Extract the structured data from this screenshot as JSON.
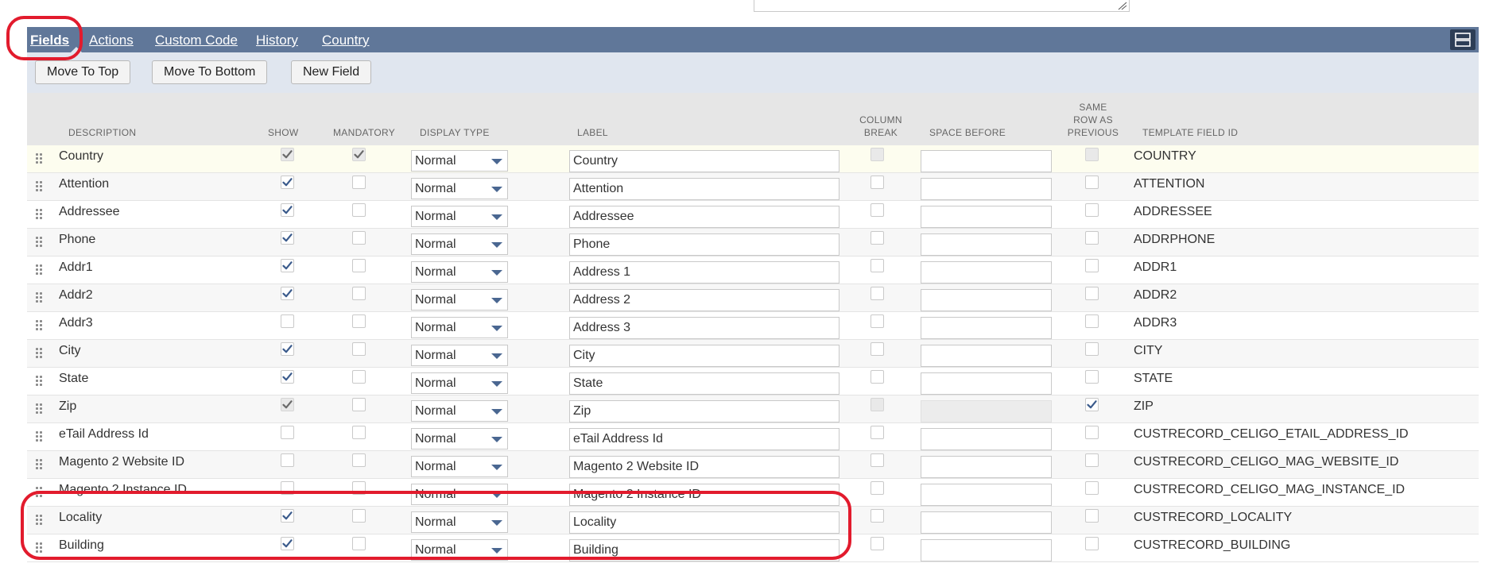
{
  "tabs": [
    {
      "label": "Fields",
      "active": true
    },
    {
      "label": "Actions",
      "active": false
    },
    {
      "label": "Custom Code",
      "active": false
    },
    {
      "label": "History",
      "active": false
    },
    {
      "label": "Country",
      "active": false
    }
  ],
  "toolbar": {
    "move_top_label": "Move To Top",
    "move_bottom_label": "Move To Bottom",
    "new_field_label": "New Field"
  },
  "columns": {
    "description": "DESCRIPTION",
    "show": "SHOW",
    "mandatory": "MANDATORY",
    "display_type": "DISPLAY TYPE",
    "label": "LABEL",
    "column_break_1": "COLUMN",
    "column_break_2": "BREAK",
    "space_before": "SPACE BEFORE",
    "same_row_1": "SAME",
    "same_row_2": "ROW AS",
    "same_row_3": "PREVIOUS",
    "template_field_id": "TEMPLATE FIELD ID"
  },
  "rows": [
    {
      "description": "Country",
      "show": true,
      "show_disabled": true,
      "mandatory": true,
      "mandatory_disabled": true,
      "display_type": "Normal",
      "label": "Country",
      "column_break_disabled": true,
      "space_before": "",
      "space_disabled": false,
      "same_row": false,
      "same_row_disabled": true,
      "template_field_id": "COUNTRY"
    },
    {
      "description": "Attention",
      "show": true,
      "show_disabled": false,
      "mandatory": false,
      "mandatory_disabled": false,
      "display_type": "Normal",
      "label": "Attention",
      "column_break_disabled": false,
      "space_before": "",
      "space_disabled": false,
      "same_row": false,
      "same_row_disabled": false,
      "template_field_id": "ATTENTION"
    },
    {
      "description": "Addressee",
      "show": true,
      "show_disabled": false,
      "mandatory": false,
      "mandatory_disabled": false,
      "display_type": "Normal",
      "label": "Addressee",
      "column_break_disabled": false,
      "space_before": "",
      "space_disabled": false,
      "same_row": false,
      "same_row_disabled": false,
      "template_field_id": "ADDRESSEE"
    },
    {
      "description": "Phone",
      "show": true,
      "show_disabled": false,
      "mandatory": false,
      "mandatory_disabled": false,
      "display_type": "Normal",
      "label": "Phone",
      "column_break_disabled": false,
      "space_before": "",
      "space_disabled": false,
      "same_row": false,
      "same_row_disabled": false,
      "template_field_id": "ADDRPHONE"
    },
    {
      "description": "Addr1",
      "show": true,
      "show_disabled": false,
      "mandatory": false,
      "mandatory_disabled": false,
      "display_type": "Normal",
      "label": "Address 1",
      "column_break_disabled": false,
      "space_before": "",
      "space_disabled": false,
      "same_row": false,
      "same_row_disabled": false,
      "template_field_id": "ADDR1"
    },
    {
      "description": "Addr2",
      "show": true,
      "show_disabled": false,
      "mandatory": false,
      "mandatory_disabled": false,
      "display_type": "Normal",
      "label": "Address 2",
      "column_break_disabled": false,
      "space_before": "",
      "space_disabled": false,
      "same_row": false,
      "same_row_disabled": false,
      "template_field_id": "ADDR2"
    },
    {
      "description": "Addr3",
      "show": false,
      "show_disabled": false,
      "mandatory": false,
      "mandatory_disabled": false,
      "display_type": "Normal",
      "label": "Address 3",
      "column_break_disabled": false,
      "space_before": "",
      "space_disabled": false,
      "same_row": false,
      "same_row_disabled": false,
      "template_field_id": "ADDR3"
    },
    {
      "description": "City",
      "show": true,
      "show_disabled": false,
      "mandatory": false,
      "mandatory_disabled": false,
      "display_type": "Normal",
      "label": "City",
      "column_break_disabled": false,
      "space_before": "",
      "space_disabled": false,
      "same_row": false,
      "same_row_disabled": false,
      "template_field_id": "CITY"
    },
    {
      "description": "State",
      "show": true,
      "show_disabled": false,
      "mandatory": false,
      "mandatory_disabled": false,
      "display_type": "Normal",
      "label": "State",
      "column_break_disabled": false,
      "space_before": "",
      "space_disabled": false,
      "same_row": false,
      "same_row_disabled": false,
      "template_field_id": "STATE"
    },
    {
      "description": "Zip",
      "show": true,
      "show_disabled": true,
      "mandatory": false,
      "mandatory_disabled": false,
      "display_type": "Normal",
      "label": "Zip",
      "column_break_disabled": true,
      "space_before": "",
      "space_disabled": true,
      "same_row": true,
      "same_row_disabled": false,
      "template_field_id": "ZIP"
    },
    {
      "description": "eTail Address Id",
      "show": false,
      "show_disabled": false,
      "mandatory": false,
      "mandatory_disabled": false,
      "display_type": "Normal",
      "label": "eTail Address Id",
      "column_break_disabled": false,
      "space_before": "",
      "space_disabled": false,
      "same_row": false,
      "same_row_disabled": false,
      "template_field_id": "CUSTRECORD_CELIGO_ETAIL_ADDRESS_ID"
    },
    {
      "description": "Magento 2 Website ID",
      "show": false,
      "show_disabled": false,
      "mandatory": false,
      "mandatory_disabled": false,
      "display_type": "Normal",
      "label": "Magento 2 Website ID",
      "column_break_disabled": false,
      "space_before": "",
      "space_disabled": false,
      "same_row": false,
      "same_row_disabled": false,
      "template_field_id": "CUSTRECORD_CELIGO_MAG_WEBSITE_ID"
    },
    {
      "description": "Magento 2 Instance ID",
      "show": false,
      "show_disabled": false,
      "mandatory": false,
      "mandatory_disabled": false,
      "display_type": "Normal",
      "label": "Magento 2 Instance ID",
      "column_break_disabled": false,
      "space_before": "",
      "space_disabled": false,
      "same_row": false,
      "same_row_disabled": false,
      "template_field_id": "CUSTRECORD_CELIGO_MAG_INSTANCE_ID"
    },
    {
      "description": "Locality",
      "show": true,
      "show_disabled": false,
      "mandatory": false,
      "mandatory_disabled": false,
      "display_type": "Normal",
      "label": "Locality",
      "column_break_disabled": false,
      "space_before": "",
      "space_disabled": false,
      "same_row": false,
      "same_row_disabled": false,
      "template_field_id": "CUSTRECORD_LOCALITY"
    },
    {
      "description": "Building",
      "show": true,
      "show_disabled": false,
      "mandatory": false,
      "mandatory_disabled": false,
      "display_type": "Normal",
      "label": "Building",
      "column_break_disabled": false,
      "space_before": "",
      "space_disabled": false,
      "same_row": false,
      "same_row_disabled": false,
      "template_field_id": "CUSTRECORD_BUILDING"
    }
  ],
  "colors": {
    "tab_bar": "#607799",
    "toolbar": "#e0e6ef",
    "checkmark": "#3b5b8c",
    "highlight": "#e21b2d"
  }
}
